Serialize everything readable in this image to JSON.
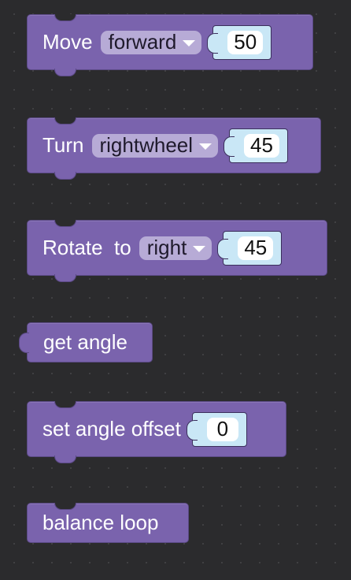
{
  "blocks": {
    "move": {
      "label": "Move",
      "dropdown": "forward",
      "value": "50"
    },
    "turn": {
      "label": "Turn",
      "dropdown": "rightwheel",
      "value": "45"
    },
    "rotate": {
      "label": "Rotate  to",
      "dropdown": "right",
      "value": "45"
    },
    "get_angle": {
      "label": "get angle"
    },
    "set_angle_offset": {
      "label": "set angle offset",
      "value": "0"
    },
    "balance_loop": {
      "label": "balance loop"
    }
  },
  "colors": {
    "background": "#2b2b2d",
    "block": "#7a63ad",
    "dropdown": "#b7abd6",
    "socket": "#c9e7f6",
    "number_field": "#ffffff"
  }
}
